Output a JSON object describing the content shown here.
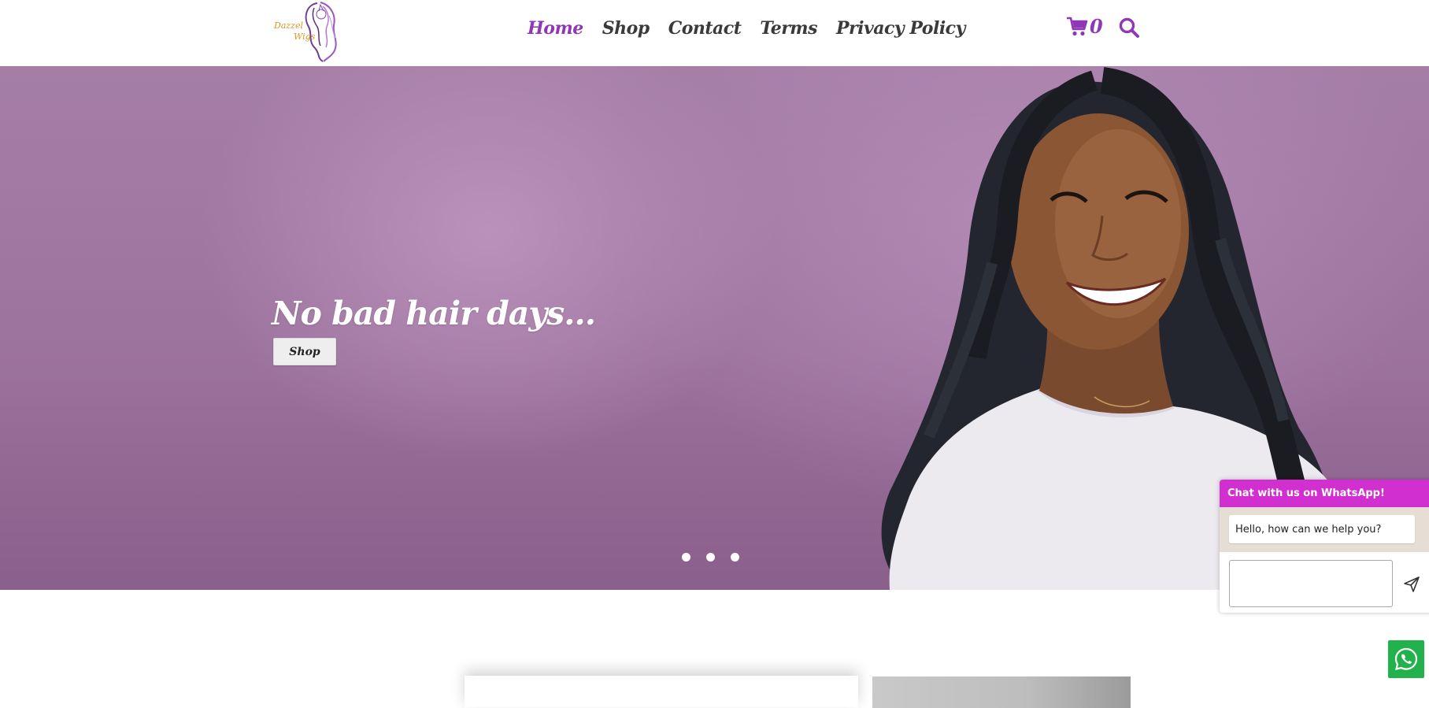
{
  "header": {
    "logo": {
      "line1": "Dazzel",
      "line2": "Wigs"
    },
    "nav": [
      {
        "label": "Home",
        "active": true
      },
      {
        "label": "Shop",
        "active": false
      },
      {
        "label": "Contact",
        "active": false
      },
      {
        "label": "Terms",
        "active": false
      },
      {
        "label": "Privacy Policy",
        "active": false
      }
    ],
    "cart": {
      "icon": "cart-icon",
      "count": "0"
    },
    "search": {
      "icon": "search-icon"
    }
  },
  "hero": {
    "headline": "No bad hair days...",
    "button_label": "Shop",
    "slide_count": 3
  },
  "chat_widget": {
    "title": "Chat with us on WhatsApp!",
    "close_icon": "close-icon",
    "greeting": "Hello, how can we help you?",
    "message_value": "",
    "send_icon": "send-icon"
  },
  "whatsapp_button": {
    "icon": "whatsapp-icon"
  },
  "colors": {
    "accent": "#8f37b4",
    "nav_text": "#3a3a3a",
    "chat_header": "#d12fd0",
    "whatsapp_green": "#22b24c",
    "hero_bg": "#9c739d"
  }
}
